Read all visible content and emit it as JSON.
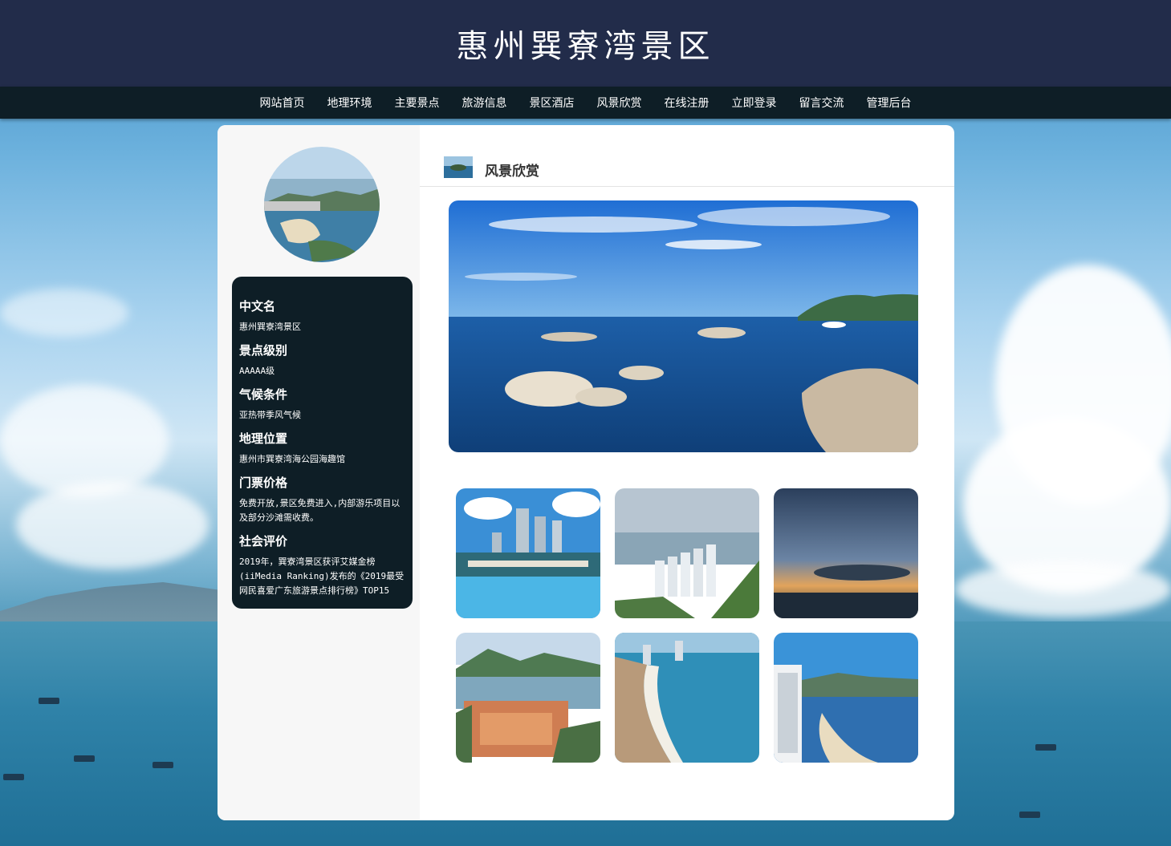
{
  "site": {
    "title": "惠州巽寮湾景区"
  },
  "nav": {
    "items": [
      "网站首页",
      "地理环境",
      "主要景点",
      "旅游信息",
      "景区酒店",
      "风景欣赏",
      "在线注册",
      "立即登录",
      "留言交流",
      "管理后台"
    ]
  },
  "sidebar": {
    "info": [
      {
        "label": "中文名",
        "value": "惠州巽寮湾景区"
      },
      {
        "label": "景点级别",
        "value": "AAAAA级"
      },
      {
        "label": "气候条件",
        "value": "亚热带季风气候"
      },
      {
        "label": "地理位置",
        "value": "惠州市巽寮湾海公园海趣馆"
      },
      {
        "label": "门票价格",
        "value": "免费开放,景区免费进入,内部游乐项目以及部分沙滩需收费。"
      },
      {
        "label": "社会评价",
        "value": "2019年，巽寮湾景区获评艾媒金榜(iiMedia Ranking)发布的《2019最受网民喜爱广东旅游景点排行榜》TOP15"
      }
    ]
  },
  "content": {
    "section_title": "风景欣赏"
  },
  "colors": {
    "header_bg": "#222c4a",
    "nav_bg": "#0e1e26",
    "card_bg": "#0e1e26"
  }
}
